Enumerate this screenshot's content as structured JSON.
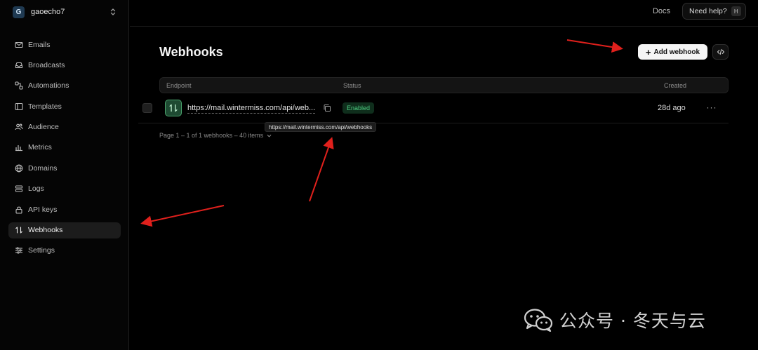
{
  "workspace": {
    "initial": "G",
    "name": "gaoecho7"
  },
  "nav": {
    "items": [
      {
        "label": "Emails",
        "icon": "mail-icon"
      },
      {
        "label": "Broadcasts",
        "icon": "inbox-icon"
      },
      {
        "label": "Automations",
        "icon": "workflow-icon"
      },
      {
        "label": "Templates",
        "icon": "template-icon"
      },
      {
        "label": "Audience",
        "icon": "users-icon"
      },
      {
        "label": "Metrics",
        "icon": "bar-chart-icon"
      },
      {
        "label": "Domains",
        "icon": "globe-icon"
      },
      {
        "label": "Logs",
        "icon": "logs-icon"
      },
      {
        "label": "API keys",
        "icon": "lock-icon"
      },
      {
        "label": "Webhooks",
        "icon": "webhook-icon",
        "active": true
      },
      {
        "label": "Settings",
        "icon": "sliders-icon"
      }
    ]
  },
  "topbar": {
    "docs": "Docs",
    "help": "Need help?",
    "help_shortcut": "H"
  },
  "page": {
    "title": "Webhooks",
    "add_button": "Add webhook"
  },
  "table": {
    "columns": {
      "endpoint": "Endpoint",
      "status": "Status",
      "created": "Created"
    },
    "rows": [
      {
        "endpoint": "https://mail.wintermiss.com/api/web...",
        "status": "Enabled",
        "created": "28d ago"
      }
    ],
    "tooltip": "https://mail.wintermiss.com/api/webhooks",
    "pagination": "Page 1 – 1 of 1 webhooks – 40 items"
  },
  "watermark": {
    "text": "公众号 · 冬天与云"
  },
  "colors": {
    "accent_green": "#4fd083",
    "annotation_red": "#e0201c",
    "background": "#000000"
  }
}
